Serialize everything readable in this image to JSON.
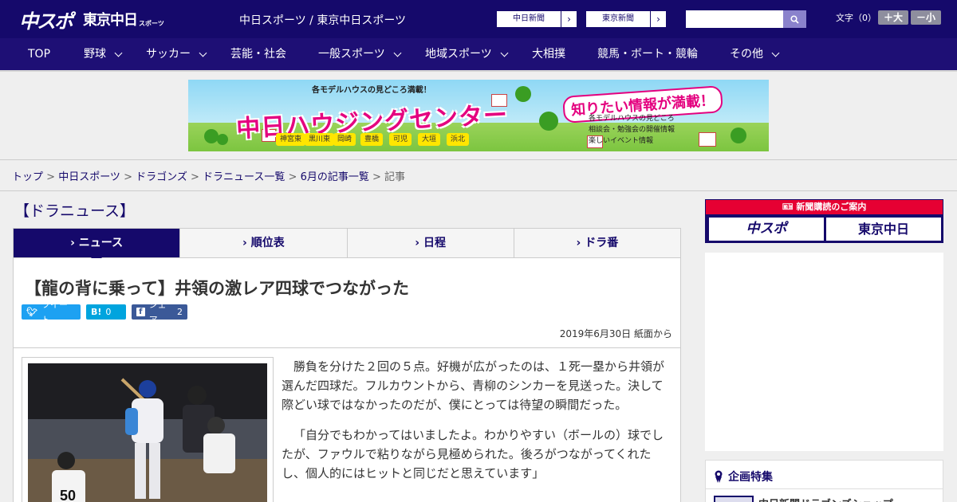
{
  "header": {
    "logo_main": "中スポ",
    "logo_sub": "東京中日",
    "logo_small": "スポーツ",
    "site_title": "中日スポーツ / 東京中日スポーツ",
    "btn_chunichi": "中日新聞",
    "btn_tokyo": "東京新聞",
    "search_placeholder": "",
    "text_size_label": "文字（0）",
    "size_up": "＋大",
    "size_down": "－小"
  },
  "nav": {
    "items": [
      {
        "label": "TOP"
      },
      {
        "label": "野球"
      },
      {
        "label": "サッカー"
      },
      {
        "label": "芸能・社会"
      },
      {
        "label": "一般スポーツ"
      },
      {
        "label": "地域スポーツ"
      },
      {
        "label": "大相撲"
      },
      {
        "label": "競馬・ボート・競輪"
      },
      {
        "label": "その他"
      }
    ]
  },
  "banner": {
    "sub": "各モデルハウスの見どころ満載！",
    "main": "中日ハウジングセンター",
    "headline": "知りたい情報が満載！",
    "list": [
      "各モデルハウスの見どころ",
      "相談会・勉強会の開催情報",
      "楽しいイベント情報"
    ],
    "locations": [
      "神宮東",
      "黒川東",
      "岡崎",
      "豊橋",
      "可児",
      "大垣",
      "浜北"
    ]
  },
  "breadcrumb": {
    "items": [
      "トップ",
      "中日スポーツ",
      "ドラゴンズ",
      "ドラニュース一覧",
      "6月の記事一覧"
    ],
    "current": "記事",
    "sep": " > "
  },
  "section_head": "【ドラニュース】",
  "tabs": [
    {
      "label": "ニュース",
      "active": true
    },
    {
      "label": "順位表",
      "active": false
    },
    {
      "label": "日程",
      "active": false
    },
    {
      "label": "ドラ番",
      "active": false
    }
  ],
  "article": {
    "title": "【龍の背に乗って】井領の激レア四球でつながった",
    "tweet_label": "ツイート",
    "hatena_label": "B!",
    "hatena_count": "0",
    "share_label": "シェア",
    "share_count": "2",
    "date": "2019年6月30日 紙面から",
    "paragraphs": [
      "勝負を分けた２回の５点。好機が広がったのは、１死一塁から井領が選んだ四球だ。フルカウントから、青柳のシンカーを見送った。決して際どい球ではなかったのだが、僕にとっては待望の瞬間だった。",
      "「自分でもわかってはいましたよ。わかりやすい（ボールの）球でしたが、ファウルで粘りながら見極められた。後ろがつながってくれたし、個人的にはヒットと同じだと思えています」"
    ]
  },
  "sidebar": {
    "subs_head": "新聞購読のご案内",
    "subs_logo_1": "中スポ",
    "subs_logo_2": "東京中日",
    "feature_head": "企画特集",
    "feature_item": "中日新聞ドラゴンズショップ"
  },
  "colors": {
    "brand": "#15096b",
    "accent_red": "#e60033",
    "twitter": "#1da1f2",
    "hatena": "#00a4de",
    "facebook": "#3b5998"
  }
}
